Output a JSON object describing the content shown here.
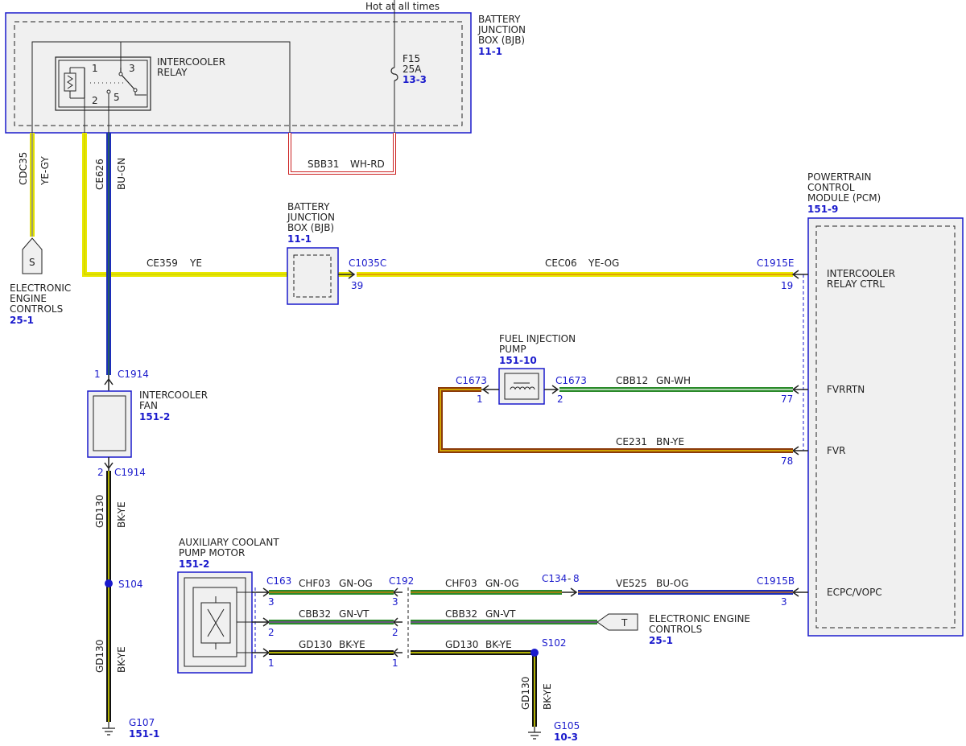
{
  "header": {
    "hot_text": "Hot at all times"
  },
  "bjb_top": {
    "line1": "BATTERY",
    "line2": "JUNCTION",
    "line3": "BOX (BJB)",
    "ref": "11-1"
  },
  "relay": {
    "line1": "INTERCOOLER",
    "line2": "RELAY",
    "pin1": "1",
    "pin2": "2",
    "pin3": "3",
    "pin5": "5"
  },
  "fuse": {
    "name": "F15",
    "rating": "25A",
    "ref": "13-3"
  },
  "sbb31": {
    "circuit": "SBB31",
    "color": "WH-RD"
  },
  "cdc35": {
    "circuit": "CDC35",
    "color": "YE-GY"
  },
  "ce626": {
    "circuit": "CE626",
    "color": "BU-GN"
  },
  "ece_left": {
    "glyph": "S",
    "line1": "ELECTRONIC",
    "line2": "ENGINE",
    "line3": "CONTROLS",
    "ref": "25-1"
  },
  "ce359": {
    "circuit": "CE359",
    "color": "YE"
  },
  "bjb_mid": {
    "line1": "BATTERY",
    "line2": "JUNCTION",
    "line3": "BOX (BJB)",
    "ref": "11-1",
    "connector": "C1035C",
    "pin": "39"
  },
  "cec06": {
    "circuit": "CEC06",
    "color": "YE-OG"
  },
  "pcm": {
    "line1": "POWERTRAIN",
    "line2": "CONTROL",
    "line3": "MODULE (PCM)",
    "ref": "151-9",
    "c1915e": "C1915E",
    "pin19": "19",
    "relay_ctrl_1": "INTERCOOLER",
    "relay_ctrl_2": "RELAY CTRL",
    "pin77": "77",
    "fvrrtn": "FVRRTN",
    "pin78": "78",
    "fvr": "FVR",
    "c1915b": "C1915B",
    "pin3": "3",
    "ecpc": "ECPC/VOPC"
  },
  "fip": {
    "line1": "FUEL INJECTION",
    "line2": "PUMP",
    "ref": "151-10",
    "conn_left": "C1673",
    "pin_left": "1",
    "conn_right": "C1673",
    "pin_right": "2"
  },
  "cbb12": {
    "circuit": "CBB12",
    "color": "GN-WH"
  },
  "ce231": {
    "circuit": "CE231",
    "color": "BN-YE"
  },
  "fan": {
    "line1": "INTERCOOLER",
    "line2": "FAN",
    "ref": "151-2",
    "pin_top": "1",
    "conn_top": "C1914",
    "pin_bot": "2",
    "conn_bot": "C1914"
  },
  "gd130_a": {
    "circuit": "GD130",
    "color": "BK-YE"
  },
  "s104": "S104",
  "gd130_b": {
    "circuit": "GD130",
    "color": "BK-YE"
  },
  "g107": {
    "name": "G107",
    "ref": "151-1"
  },
  "acpm": {
    "line1": "AUXILIARY COOLANT",
    "line2": "PUMP MOTOR",
    "ref": "151-2"
  },
  "c163": {
    "name": "C163",
    "pin3": "3",
    "pin2": "2",
    "pin1": "1"
  },
  "c192": {
    "name": "C192",
    "pin3": "3",
    "pin2": "2",
    "pin1": "1"
  },
  "chf03_a": {
    "circuit": "CHF03",
    "color": "GN-OG"
  },
  "chf03_b": {
    "circuit": "CHF03",
    "color": "GN-OG"
  },
  "c134": {
    "name": "C134",
    "pin": "8"
  },
  "ve525": {
    "circuit": "VE525",
    "color": "BU-OG"
  },
  "cbb32_a": {
    "circuit": "CBB32",
    "color": "GN-VT"
  },
  "cbb32_b": {
    "circuit": "CBB32",
    "color": "GN-VT"
  },
  "ece_right": {
    "glyph": "T",
    "line1": "ELECTRONIC ENGINE",
    "line2": "CONTROLS",
    "ref": "25-1"
  },
  "gd130_c": {
    "circuit": "GD130",
    "color": "BK-YE"
  },
  "gd130_d": {
    "circuit": "GD130",
    "color": "BK-YE"
  },
  "s102": "S102",
  "gd130_e": {
    "circuit": "GD130",
    "color": "BK-YE"
  },
  "g105": {
    "name": "G105",
    "ref": "10-3"
  }
}
